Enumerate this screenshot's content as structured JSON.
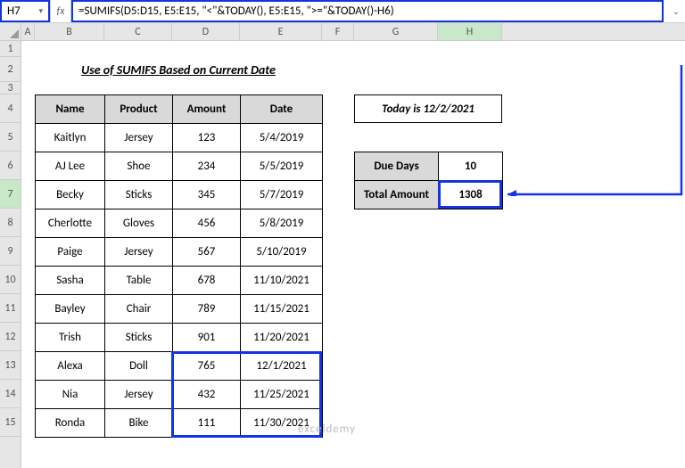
{
  "namebox": "H7",
  "formula": "=SUMIFS(D5:D15, E5:E15, \"<\"&TODAY(), E5:E15, \">=\"&TODAY()-H6)",
  "columns": [
    "A",
    "B",
    "C",
    "D",
    "E",
    "F",
    "G",
    "H"
  ],
  "rows": [
    "1",
    "2",
    "3",
    "4",
    "5",
    "6",
    "7",
    "8",
    "9",
    "10",
    "11",
    "12",
    "13",
    "14",
    "15"
  ],
  "title": "Use of SUMIFS Based on Current Date",
  "table": {
    "headers": [
      "Name",
      "Product",
      "Amount",
      "Date"
    ],
    "rows": [
      {
        "name": "Kaitlyn",
        "product": "Jersey",
        "amount": "123",
        "date": "5/4/2019"
      },
      {
        "name": "AJ Lee",
        "product": "Shoe",
        "amount": "234",
        "date": "5/5/2019"
      },
      {
        "name": "Becky",
        "product": "Sticks",
        "amount": "345",
        "date": "5/7/2019"
      },
      {
        "name": "Cherlotte",
        "product": "Gloves",
        "amount": "456",
        "date": "5/8/2019"
      },
      {
        "name": "Paige",
        "product": "Jersey",
        "amount": "567",
        "date": "5/10/2019"
      },
      {
        "name": "Sasha",
        "product": "Table",
        "amount": "678",
        "date": "11/10/2021"
      },
      {
        "name": "Bayley",
        "product": "Chair",
        "amount": "789",
        "date": "11/15/2021"
      },
      {
        "name": "Trish",
        "product": "Sticks",
        "amount": "901",
        "date": "11/20/2021"
      },
      {
        "name": "Alexa",
        "product": "Doll",
        "amount": "765",
        "date": "12/1/2021"
      },
      {
        "name": "Nia",
        "product": "Jersey",
        "amount": "432",
        "date": "11/25/2021"
      },
      {
        "name": "Ronda",
        "product": "Bike",
        "amount": "111",
        "date": "11/30/2021"
      }
    ]
  },
  "today_label": "Today is 12/2/2021",
  "side": {
    "due_days_label": "Due Days",
    "due_days_value": "10",
    "total_label": "Total Amount",
    "total_value": "1308"
  },
  "watermark": "exceldemy"
}
